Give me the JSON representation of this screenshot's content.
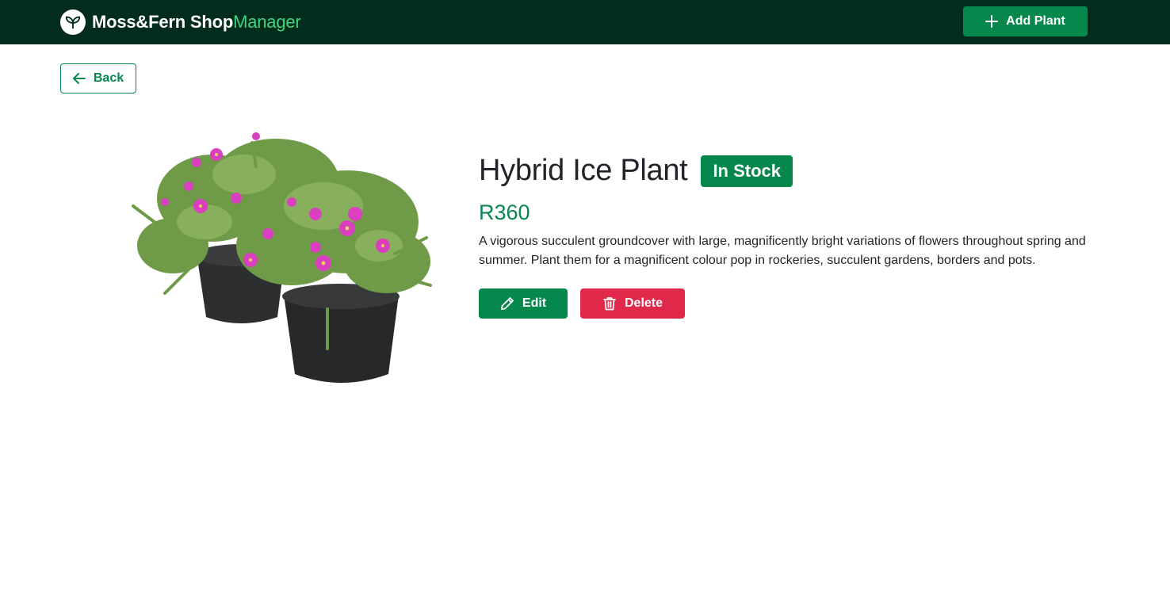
{
  "navbar": {
    "brand_main": "Moss&Fern Shop",
    "brand_accent": "Manager",
    "logo_icon": "leaf-icon",
    "add_button_label": "Add Plant",
    "add_button_icon": "plus-icon"
  },
  "back_button": {
    "label": "Back",
    "icon": "arrow-left-icon"
  },
  "product": {
    "name": "Hybrid Ice Plant",
    "stock_status": "In Stock",
    "price": "R360",
    "description": "A vigorous succulent groundcover with large, magnificently bright variations of flowers throughout spring and summer. Plant them for a magnificent colour pop in rockeries, succulent gardens, borders and pots.",
    "image_subject": "potted ice plants with pink flowers"
  },
  "actions": {
    "edit_label": "Edit",
    "edit_icon": "pencil-icon",
    "delete_label": "Delete",
    "delete_icon": "trash-icon"
  },
  "colors": {
    "navbar_bg": "#022c1c",
    "primary": "#06874c",
    "brand_accent": "#3fd47d",
    "danger": "#e0284a"
  }
}
